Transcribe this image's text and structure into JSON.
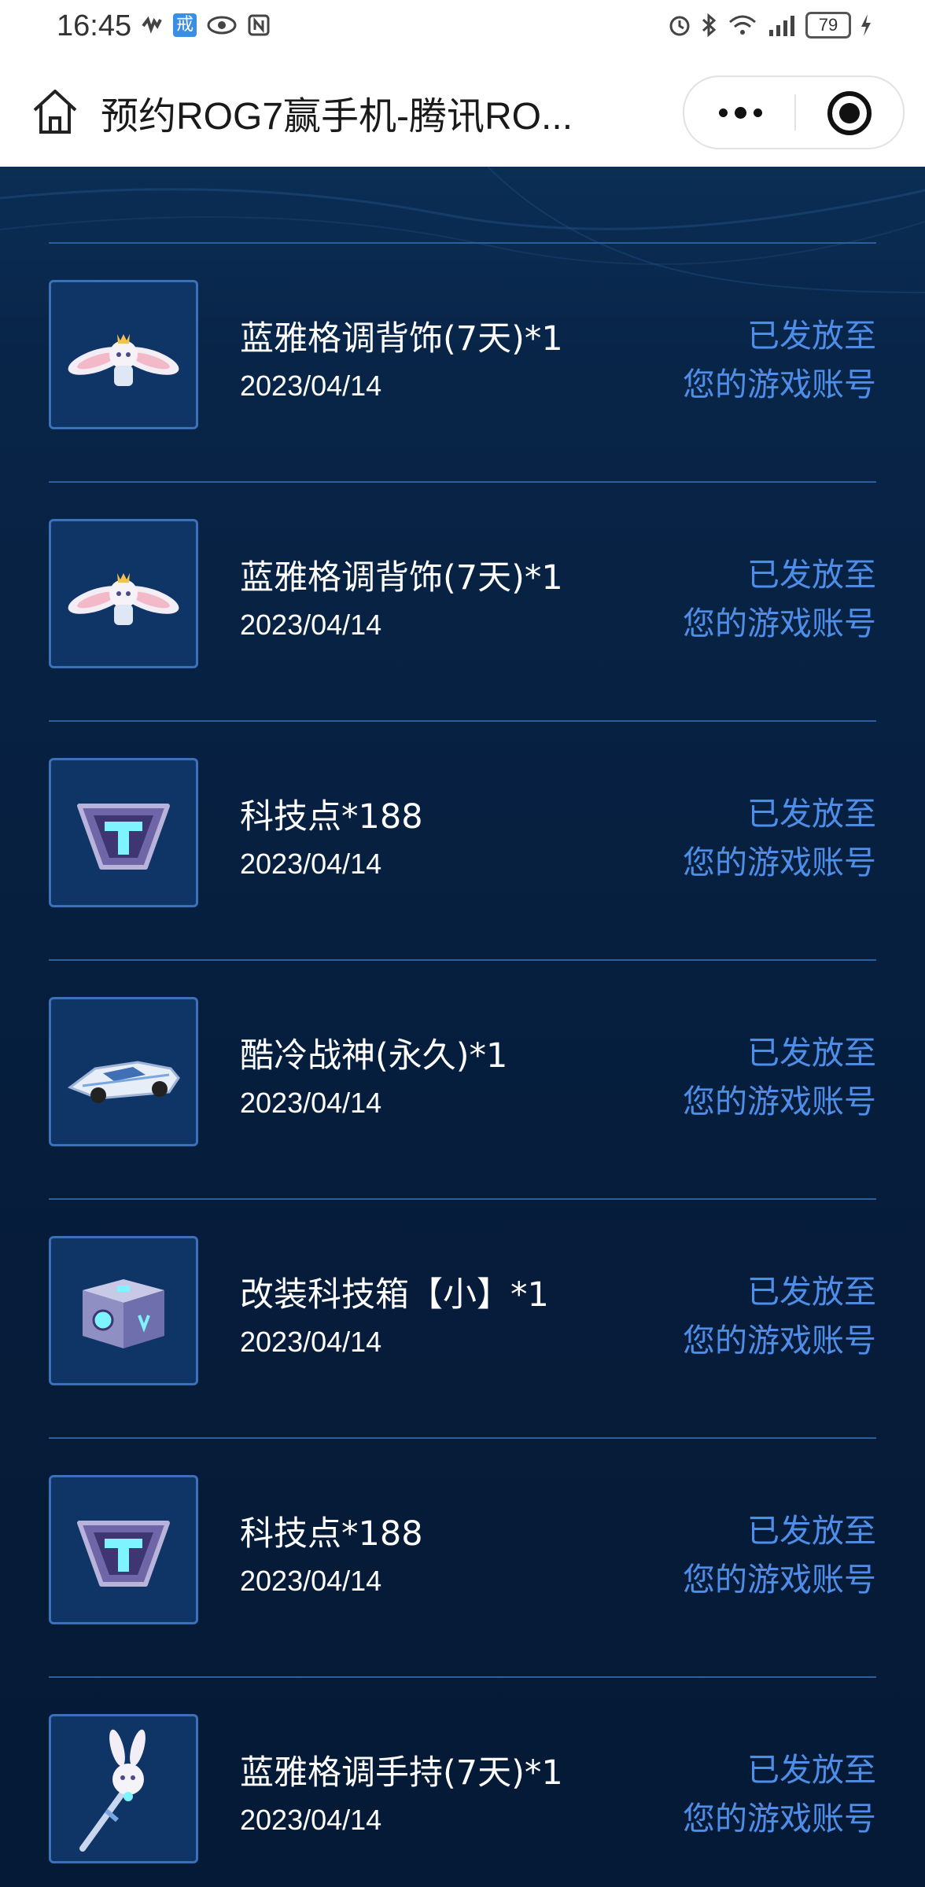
{
  "status_bar": {
    "time": "16:45",
    "battery": "79",
    "app_chip": "戒"
  },
  "nav": {
    "title": "预约ROG7赢手机-腾讯RO..."
  },
  "records": [
    {
      "name": "蓝雅格调背饰(7天)*1",
      "date": "2023/04/14",
      "status_line1": "已发放至",
      "status_line2": "您的游戏账号",
      "icon": "bunny-back-accessory-icon"
    },
    {
      "name": "蓝雅格调背饰(7天)*1",
      "date": "2023/04/14",
      "status_line1": "已发放至",
      "status_line2": "您的游戏账号",
      "icon": "bunny-back-accessory-icon"
    },
    {
      "name": "科技点*188",
      "date": "2023/04/14",
      "status_line1": "已发放至",
      "status_line2": "您的游戏账号",
      "icon": "tech-points-icon"
    },
    {
      "name": "酷冷战神(永久)*1",
      "date": "2023/04/14",
      "status_line1": "已发放至",
      "status_line2": "您的游戏账号",
      "icon": "race-car-icon"
    },
    {
      "name": "改装科技箱【小】*1",
      "date": "2023/04/14",
      "status_line1": "已发放至",
      "status_line2": "您的游戏账号",
      "icon": "tech-box-icon"
    },
    {
      "name": "科技点*188",
      "date": "2023/04/14",
      "status_line1": "已发放至",
      "status_line2": "您的游戏账号",
      "icon": "tech-points-icon"
    },
    {
      "name": "蓝雅格调手持(7天)*1",
      "date": "2023/04/14",
      "status_line1": "已发放至",
      "status_line2": "您的游戏账号",
      "icon": "bunny-handheld-icon"
    }
  ]
}
